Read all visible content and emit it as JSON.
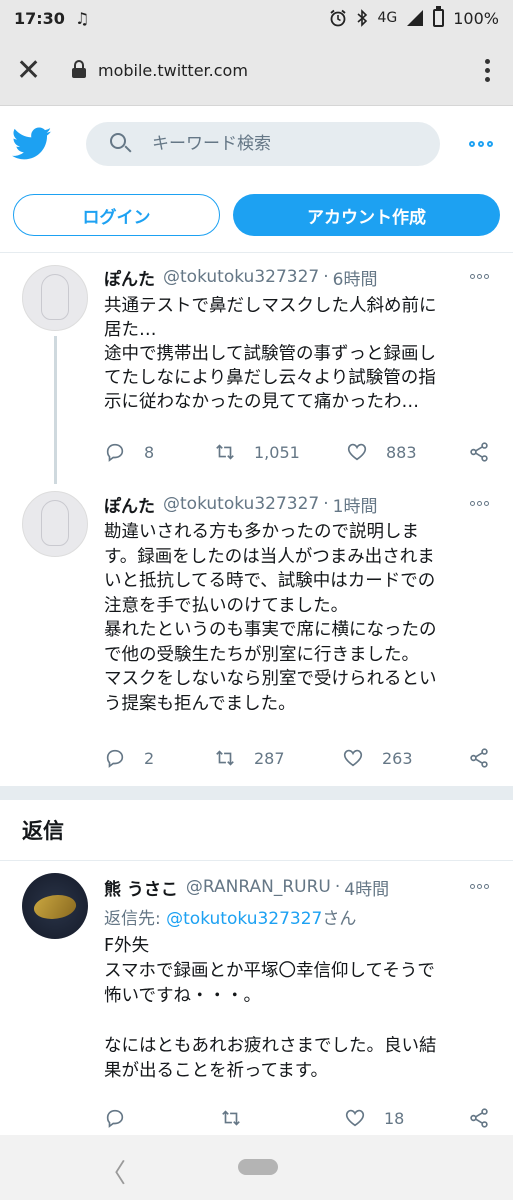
{
  "status_bar": {
    "time": "17:30",
    "network": "4G",
    "battery": "100%"
  },
  "browser": {
    "url": "mobile.twitter.com"
  },
  "header": {
    "search_placeholder": "キーワード検索"
  },
  "auth": {
    "login_label": "ログイン",
    "signup_label": "アカウント作成"
  },
  "tweets": [
    {
      "name": "ぽんた",
      "handle": "@tokutoku327327",
      "sep": "·",
      "time": "6時間",
      "lines": [
        "共通テストで鼻だしマスクした人斜め前に",
        "居た…",
        "途中で携帯出して試験管の事ずっと録画し",
        "てたしなにより鼻だし云々より試験管の指",
        "示に従わなかったの見てて痛かったわ…"
      ],
      "replies": "8",
      "retweets": "1,051",
      "likes": "883"
    },
    {
      "name": "ぽんた",
      "handle": "@tokutoku327327",
      "sep": "·",
      "time": "1時間",
      "lines": [
        "勘違いされる方も多かったので説明しま",
        "す。録画をしたのは当人がつまみ出されま",
        "いと抵抗してる時で、試験中はカードでの",
        "注意を手で払いのけてました。",
        "暴れたというのも事実で席に横になったの",
        "で他の受験生たちが別室に行きました。",
        "マスクをしないなら別室で受けられるとい",
        "う提案も拒んでました。"
      ],
      "replies": "2",
      "retweets": "287",
      "likes": "263"
    }
  ],
  "replies_section": {
    "title": "返信"
  },
  "reply": {
    "name": "熊 うさこ",
    "handle": "@RANRAN_RURU",
    "sep": "·",
    "time": "4時間",
    "replying_prefix": "返信先: ",
    "replying_to": "@tokutoku327327",
    "replying_suffix": "さん",
    "lines": [
      "F外失",
      "スマホで録画とか平塚〇幸信仰してそうで",
      "怖いですね・・・。",
      "",
      "なにはともあれお疲れさまでした。良い結",
      "果が出ることを祈ってます。"
    ],
    "likes": "18"
  },
  "colors": {
    "brand": "#1da1f2",
    "muted": "#657786",
    "divider": "#e6ecf0"
  },
  "icons": [
    "close-icon",
    "lock-icon",
    "more-vert-icon",
    "twitter-bird-icon",
    "search-icon",
    "more-horizontal-icon",
    "reply-icon",
    "retweet-icon",
    "like-icon",
    "share-icon",
    "music-note-icon",
    "alarm-icon",
    "bluetooth-icon",
    "signal-icon",
    "battery-icon",
    "nav-back-icon",
    "nav-home-icon"
  ]
}
